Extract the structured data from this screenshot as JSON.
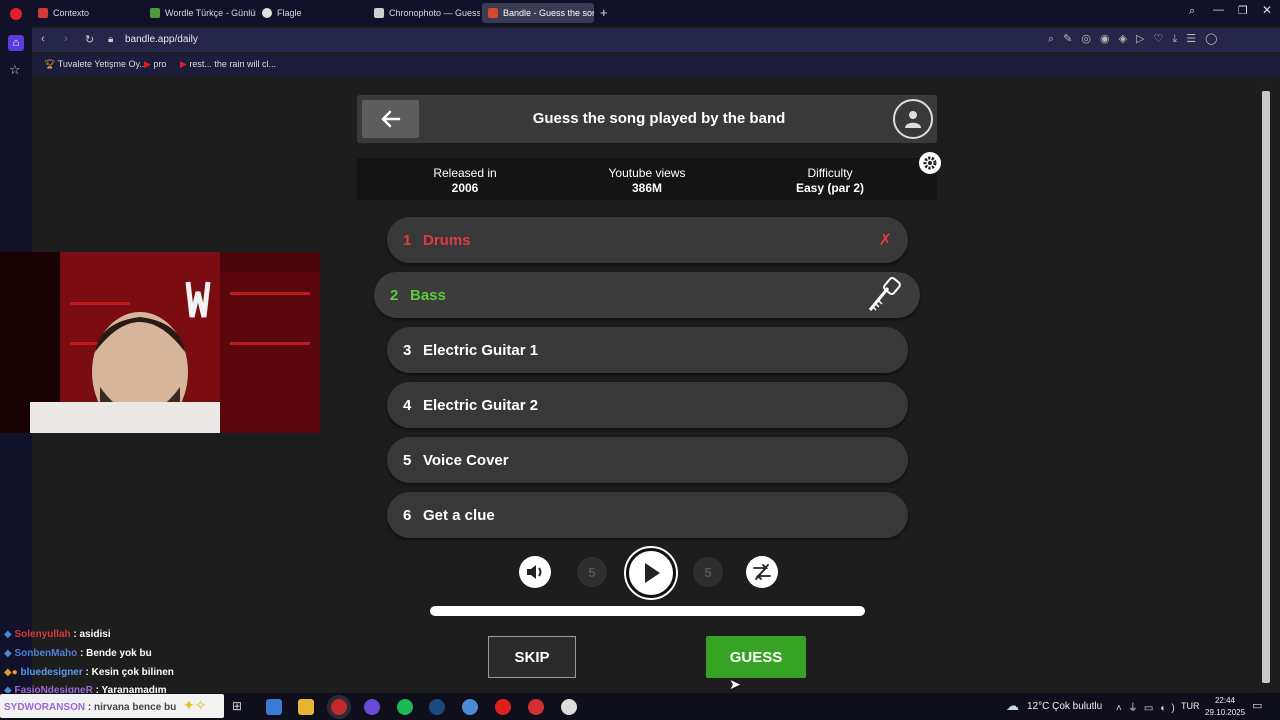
{
  "browser": {
    "tabs": [
      {
        "label": "Contexto",
        "color": "#d23a3a",
        "active": false
      },
      {
        "label": "Wordle Türkçe - Günlük K",
        "color": "#4c9a3a",
        "active": false
      },
      {
        "label": "Flagle",
        "color": "#e0e0e0",
        "active": false
      },
      {
        "label": "Chronophoto — Guess the",
        "color": "#cfcfcf",
        "active": false
      },
      {
        "label": "Bandle - Guess the song,",
        "color": "#d44a2a",
        "active": true
      }
    ],
    "url": "bandle.app/daily",
    "bookmarks": [
      "Tuvalete Yetişme Oy...",
      "pro",
      "rest... the rain will cl..."
    ]
  },
  "game": {
    "title": "Guess the song played by the band",
    "info": {
      "released_label": "Released in",
      "released_value": "2006",
      "views_label": "Youtube views",
      "views_value": "386M",
      "difficulty_label": "Difficulty",
      "difficulty_value": "Easy (par 2)"
    },
    "tracks": [
      {
        "num": "1",
        "label": "Drums",
        "state": "missed"
      },
      {
        "num": "2",
        "label": "Bass",
        "state": "current"
      },
      {
        "num": "3",
        "label": "Electric Guitar 1",
        "state": "locked"
      },
      {
        "num": "4",
        "label": "Electric Guitar 2",
        "state": "locked"
      },
      {
        "num": "5",
        "label": "Voice Cover",
        "state": "locked"
      },
      {
        "num": "6",
        "label": "Get a clue",
        "state": "locked"
      }
    ],
    "rewind_seconds": "5",
    "forward_seconds": "5",
    "progress": 1.0,
    "skip_label": "SKIP",
    "guess_label": "GUESS",
    "colors": {
      "missed": "#e03a47",
      "current": "#5ccb3a",
      "guess": "#36a324"
    }
  },
  "chat": [
    {
      "user": "Solenyullah",
      "text": ": asidisi",
      "color": "#d33b3b"
    },
    {
      "user": "SonbenMaho",
      "text": ": Bende yok bu",
      "color": "#4e7fd6"
    },
    {
      "user": "bluedesigner",
      "text": ": Kesin çok bilinen",
      "color": "#5a9af0"
    },
    {
      "user": "FasioNdesigneR",
      "text": ": Yaranamadım",
      "color": "#9b6ad6"
    },
    {
      "user": "SYDWORANSON",
      "text": ": nirvana bence bu",
      "color": "#9b6ad6"
    }
  ],
  "taskbar": {
    "weather": "12°C  Çok bulutlu",
    "lang": "TUR",
    "time": "22:44",
    "date": "29.10.2025"
  }
}
